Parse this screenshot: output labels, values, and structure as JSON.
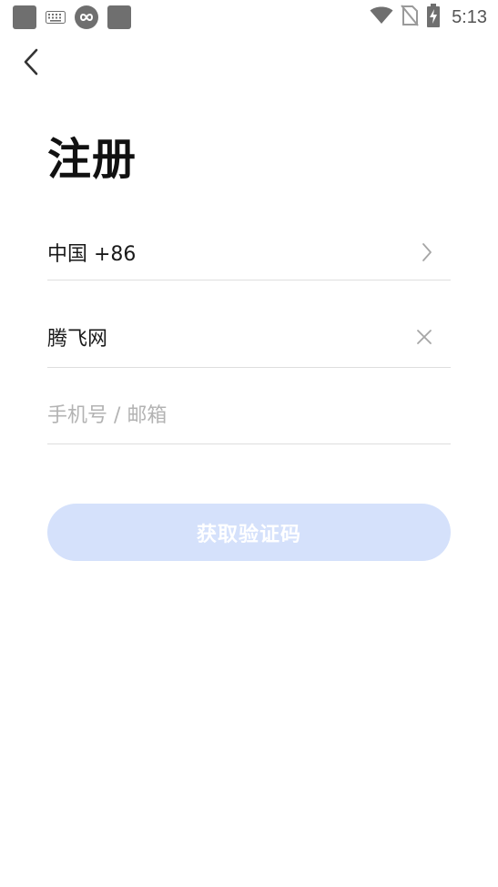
{
  "status_bar": {
    "time": "5:13",
    "left_icons": [
      "app-square-icon",
      "keyboard-icon",
      "infinity-circle-icon",
      "app-square-icon"
    ],
    "right_icons": [
      "wifi-icon",
      "no-sim-icon",
      "battery-charging-icon"
    ]
  },
  "header": {
    "back_icon": "chevron-left-icon"
  },
  "page": {
    "title": "注册"
  },
  "form": {
    "country": {
      "value": "中国 +86",
      "icon": "chevron-right-icon"
    },
    "name": {
      "value": "腾飞网",
      "icon": "clear-icon"
    },
    "account": {
      "value": "",
      "placeholder": "手机号 / 邮箱"
    },
    "submit_label": "获取验证码"
  },
  "colors": {
    "button_bg": "#d5e1fb",
    "divider": "#dedede",
    "placeholder": "#b3b3b3",
    "status_icon": "#6f6f6f"
  }
}
